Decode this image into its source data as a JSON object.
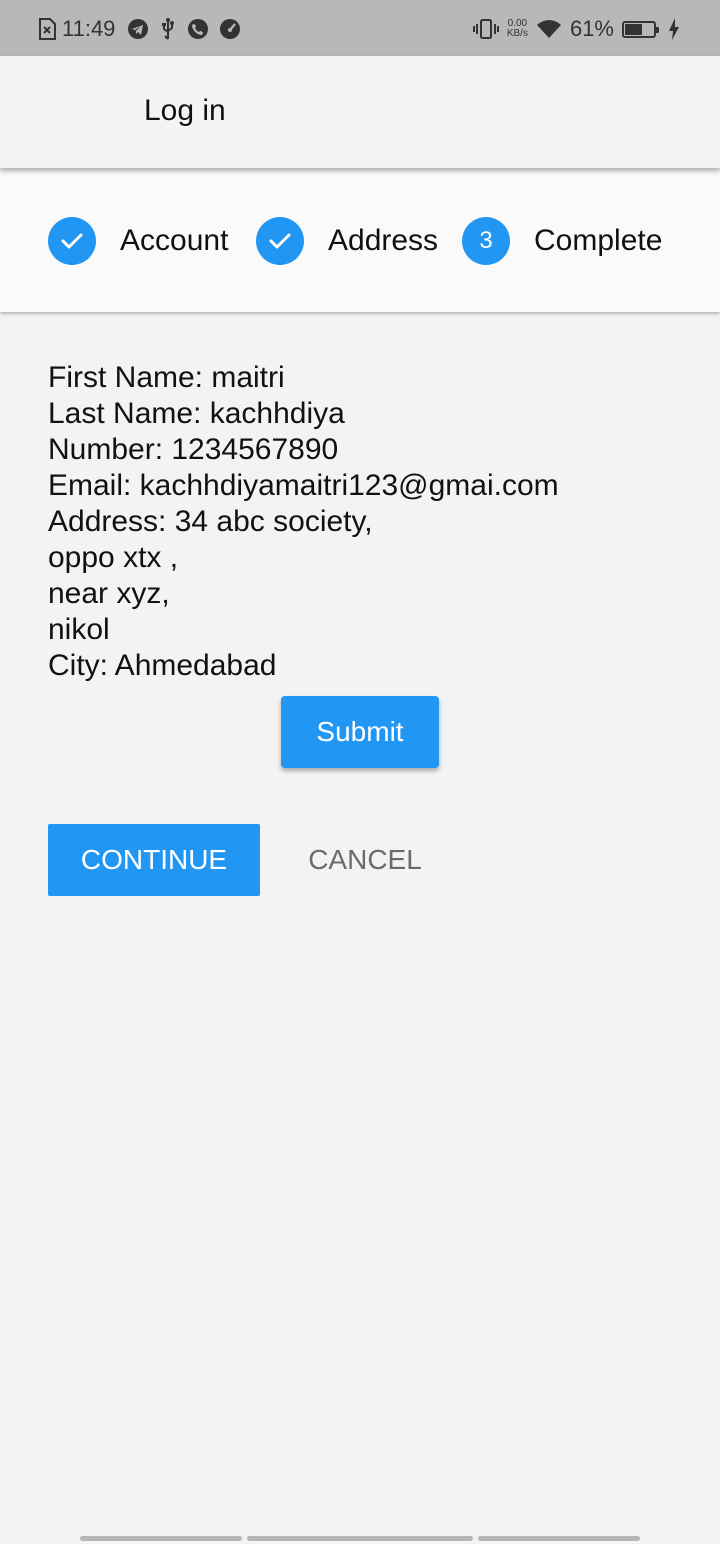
{
  "status_bar": {
    "time": "11:49",
    "speed_value": "0.00",
    "speed_unit": "KB/s",
    "battery_percent": "61%",
    "battery_level": 0.61,
    "icons": [
      "sim-off-icon",
      "telegram-icon",
      "usb-icon",
      "phone-call-icon",
      "speedometer-icon",
      "vibrate-icon",
      "wifi-icon",
      "battery-icon",
      "charging-icon"
    ]
  },
  "app_bar": {
    "title": "Log in"
  },
  "stepper": {
    "accent_color": "#2196f3",
    "steps": [
      {
        "label": "Account",
        "state": "done"
      },
      {
        "label": "Address",
        "state": "done"
      },
      {
        "label": "Complete",
        "state": "active",
        "number": "3"
      }
    ]
  },
  "summary": {
    "lines": [
      "First Name: maitri",
      "Last Name: kachhdiya",
      "Number: 1234567890",
      "Email: kachhdiyamaitri123@gmai.com",
      "Address: 34 abc society,",
      "oppo xtx ,",
      "near xyz,",
      "nikol",
      "City: Ahmedabad"
    ]
  },
  "buttons": {
    "submit": "Submit",
    "continue": "CONTINUE",
    "cancel": "CANCEL"
  }
}
